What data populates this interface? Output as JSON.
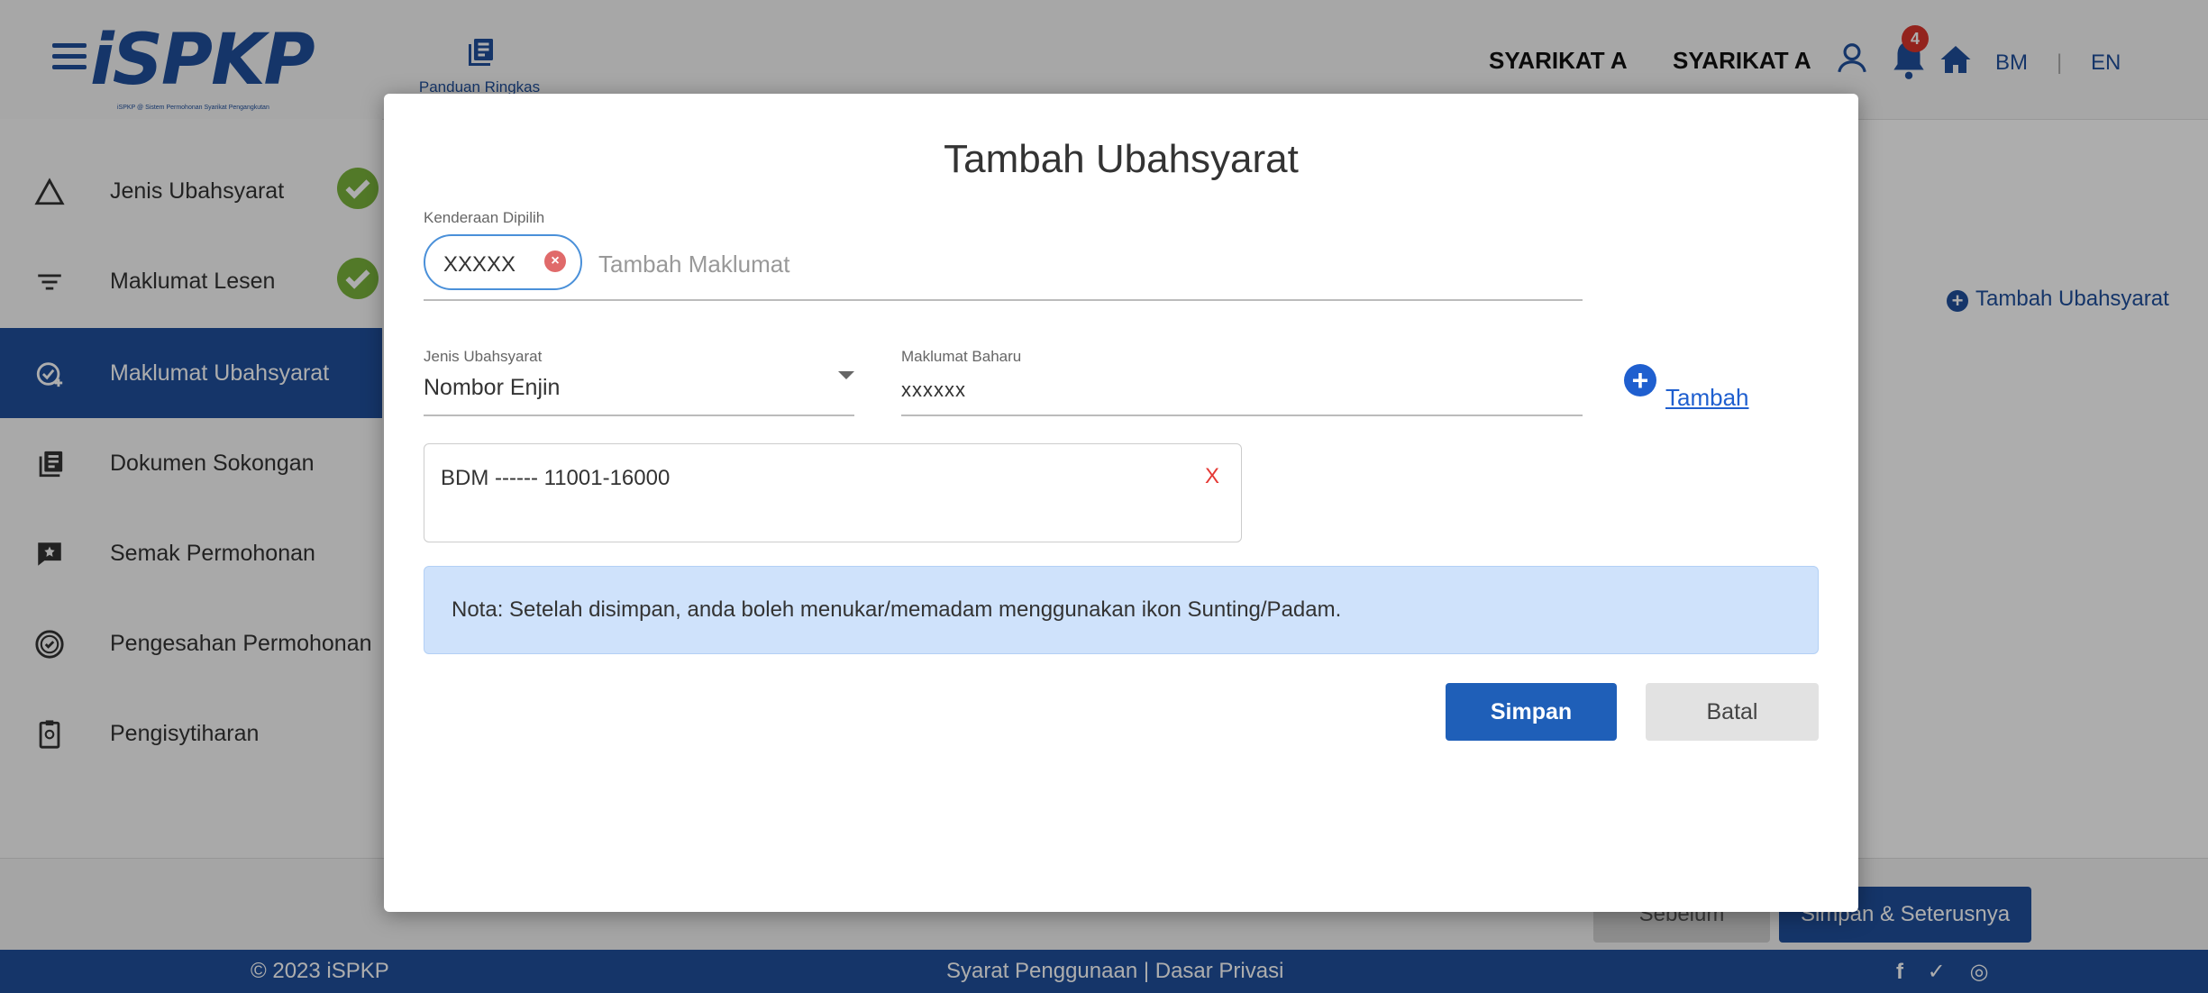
{
  "header": {
    "logo": "iSPKP",
    "logo_sub": "iSPKP @ Sistem Permohonan Syarikat Pengangkutan",
    "guide_label": "Panduan Ringkas",
    "company_1": "SYARIKAT A",
    "company_2": "SYARIKAT A",
    "notification_count": "4",
    "lang_bm": "BM",
    "lang_sep": "|",
    "lang_en": "EN"
  },
  "sidebar": {
    "items": [
      {
        "label": "Jenis Ubahsyarat",
        "icon": "triangle-icon",
        "done": true
      },
      {
        "label": "Maklumat Lesen",
        "icon": "filter-icon",
        "done": true
      },
      {
        "label": "Maklumat Ubahsyarat",
        "icon": "check-add-icon",
        "active": true
      },
      {
        "label": "Dokumen Sokongan",
        "icon": "document-icon"
      },
      {
        "label": "Semak Permohonan",
        "icon": "review-icon"
      },
      {
        "label": "Pengesahan Permohonan",
        "icon": "verify-icon"
      },
      {
        "label": "Pengisytiharan",
        "icon": "clipboard-icon"
      }
    ]
  },
  "page": {
    "add_change_link": "Tambah Ubahsyarat",
    "prev_button": "Sebelum",
    "next_button": "Simpan & Seterusnya"
  },
  "modal": {
    "title": "Tambah Ubahsyarat",
    "vehicle_label": "Kenderaan Dipilih",
    "vehicle_chip": "XXXXX",
    "vehicle_placeholder": "Tambah Maklumat",
    "type_label": "Jenis Ubahsyarat",
    "type_value": "Nombor Enjin",
    "new_info_label": "Maklumat Baharu",
    "new_info_value": "xxxxxx",
    "add_button": "Tambah",
    "list_item": "BDM ------ 11001-16000",
    "list_remove": "X",
    "note": "Nota: Setelah disimpan, anda boleh menukar/memadam menggunakan ikon Sunting/Padam.",
    "save_button": "Simpan",
    "cancel_button": "Batal"
  },
  "footer": {
    "copyright": "© 2023 iSPKP",
    "links": "Syarat Penggunaan | Dasar Privasi",
    "social": "f ✓ ◎"
  },
  "colors": {
    "primary": "#1f4f9b",
    "accent": "#1f5fcf",
    "success": "#7ab33c",
    "danger": "#e53935",
    "note_bg": "#cfe2fb"
  }
}
